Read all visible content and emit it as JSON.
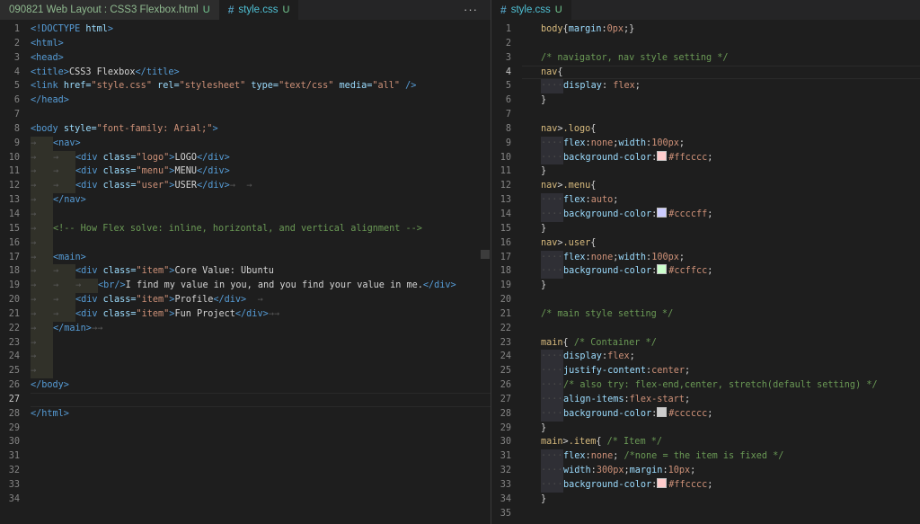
{
  "left_tabs": [
    {
      "label": "090821 Web Layout : CSS3 Flexbox.html",
      "badge": "U",
      "active": false
    },
    {
      "label": "style.css",
      "badge": "U",
      "active": true
    }
  ],
  "right_tab": {
    "label": "style.css",
    "badge": "U"
  },
  "more_actions": "···",
  "html_lines": [
    {
      "n": "1",
      "code": [
        [
          "tg",
          "<!DOCTYPE "
        ],
        [
          "at",
          "html"
        ],
        [
          "tg",
          ">"
        ]
      ]
    },
    {
      "n": "2",
      "code": [
        [
          "tg",
          "<html>"
        ]
      ]
    },
    {
      "n": "3",
      "code": [
        [
          "tg",
          "<head>"
        ]
      ]
    },
    {
      "n": "4",
      "code": [
        [
          "tg",
          "<title>"
        ],
        [
          "pl",
          "CSS3 Flexbox"
        ],
        [
          "tg",
          "</title>"
        ]
      ]
    },
    {
      "n": "5",
      "code": [
        [
          "tg",
          "<link "
        ],
        [
          "at",
          "href="
        ],
        [
          "st",
          "\"style.css\""
        ],
        [
          "pl",
          " "
        ],
        [
          "at",
          "rel="
        ],
        [
          "st",
          "\"stylesheet\""
        ],
        [
          "pl",
          " "
        ],
        [
          "at",
          "type="
        ],
        [
          "st",
          "\"text/css\""
        ],
        [
          "pl",
          " "
        ],
        [
          "at",
          "media="
        ],
        [
          "st",
          "\"all\""
        ],
        [
          "pl",
          " "
        ],
        [
          "tg",
          "/>"
        ]
      ]
    },
    {
      "n": "6",
      "code": [
        [
          "tg",
          "</head>"
        ]
      ]
    },
    {
      "n": "7",
      "code": []
    },
    {
      "n": "8",
      "code": [
        [
          "tg",
          "<body "
        ],
        [
          "at",
          "style="
        ],
        [
          "st",
          "\"font-family: Arial;\""
        ],
        [
          "tg",
          ">"
        ]
      ]
    },
    {
      "n": "9",
      "indent": 1,
      "code": [
        [
          "tg",
          "<nav>"
        ]
      ]
    },
    {
      "n": "10",
      "indent": 2,
      "code": [
        [
          "tg",
          "<div "
        ],
        [
          "at",
          "class="
        ],
        [
          "st",
          "\"logo\""
        ],
        [
          "tg",
          ">"
        ],
        [
          "pl",
          "LOGO"
        ],
        [
          "tg",
          "</div>"
        ]
      ]
    },
    {
      "n": "11",
      "indent": 2,
      "code": [
        [
          "tg",
          "<div "
        ],
        [
          "at",
          "class="
        ],
        [
          "st",
          "\"menu\""
        ],
        [
          "tg",
          ">"
        ],
        [
          "pl",
          "MENU"
        ],
        [
          "tg",
          "</div>"
        ]
      ]
    },
    {
      "n": "12",
      "indent": 2,
      "code": [
        [
          "tg",
          "<div "
        ],
        [
          "at",
          "class="
        ],
        [
          "st",
          "\"user\""
        ],
        [
          "tg",
          ">"
        ],
        [
          "pl",
          "USER"
        ],
        [
          "tg",
          "</div>"
        ],
        [
          "ar",
          "→  →"
        ]
      ]
    },
    {
      "n": "13",
      "indent": 1,
      "code": [
        [
          "tg",
          "</nav>"
        ]
      ]
    },
    {
      "n": "14",
      "indent": 1,
      "code": []
    },
    {
      "n": "15",
      "indent": 1,
      "code": [
        [
          "cm",
          "<!-- How Flex solve: inline, horizontal, and vertical alignment -->"
        ]
      ]
    },
    {
      "n": "16",
      "indent": 1,
      "code": []
    },
    {
      "n": "17",
      "indent": 1,
      "code": [
        [
          "tg",
          "<main>"
        ]
      ]
    },
    {
      "n": "18",
      "indent": 2,
      "code": [
        [
          "tg",
          "<div "
        ],
        [
          "at",
          "class="
        ],
        [
          "st",
          "\"item\""
        ],
        [
          "tg",
          ">"
        ],
        [
          "pl",
          "Core Value: Ubuntu"
        ]
      ]
    },
    {
      "n": "19",
      "indent": 3,
      "code": [
        [
          "tg",
          "<br/>"
        ],
        [
          "pl",
          "I find my value in you, and you find your value in me."
        ],
        [
          "tg",
          "</div>"
        ]
      ]
    },
    {
      "n": "20",
      "indent": 2,
      "code": [
        [
          "tg",
          "<div "
        ],
        [
          "at",
          "class="
        ],
        [
          "st",
          "\"item\""
        ],
        [
          "tg",
          ">"
        ],
        [
          "pl",
          "Profile"
        ],
        [
          "tg",
          "</div>"
        ],
        [
          "ar",
          "  →"
        ]
      ]
    },
    {
      "n": "21",
      "indent": 2,
      "code": [
        [
          "tg",
          "<div "
        ],
        [
          "at",
          "class="
        ],
        [
          "st",
          "\"item\""
        ],
        [
          "tg",
          ">"
        ],
        [
          "pl",
          "Fun Project"
        ],
        [
          "tg",
          "</div>"
        ],
        [
          "ar",
          "→→"
        ]
      ]
    },
    {
      "n": "22",
      "indent": 1,
      "code": [
        [
          "tg",
          "</main>"
        ],
        [
          "ar",
          "→→"
        ]
      ]
    },
    {
      "n": "23",
      "indent": 1,
      "code": []
    },
    {
      "n": "24",
      "indent": 1,
      "code": []
    },
    {
      "n": "25",
      "indent": 1,
      "code": []
    },
    {
      "n": "26",
      "code": [
        [
          "tg",
          "</body>"
        ]
      ]
    },
    {
      "n": "27",
      "code": [],
      "current": true
    },
    {
      "n": "28",
      "code": [
        [
          "tg",
          "</html>"
        ]
      ]
    },
    {
      "n": "29",
      "code": []
    },
    {
      "n": "30",
      "code": []
    },
    {
      "n": "31",
      "code": []
    },
    {
      "n": "32",
      "code": []
    },
    {
      "n": "33",
      "code": []
    },
    {
      "n": "34",
      "code": []
    }
  ],
  "css_lines": [
    {
      "n": "1",
      "code": [
        [
          "sel",
          "body"
        ],
        [
          "pl",
          "{"
        ],
        [
          "pr",
          "margin"
        ],
        [
          "pl",
          ":"
        ],
        [
          "vl",
          "0px"
        ],
        [
          "pl",
          ";}"
        ]
      ]
    },
    {
      "n": "2",
      "code": []
    },
    {
      "n": "3",
      "code": [
        [
          "cm",
          "/* navigator, nav style setting */"
        ]
      ]
    },
    {
      "n": "4",
      "current": true,
      "code": [
        [
          "sel",
          "nav"
        ],
        [
          "pl",
          "{"
        ]
      ]
    },
    {
      "n": "5",
      "indent": 1,
      "code": [
        [
          "pr",
          "display"
        ],
        [
          "pl",
          ": "
        ],
        [
          "vl",
          "flex"
        ],
        [
          "pl",
          ";"
        ]
      ]
    },
    {
      "n": "6",
      "code": [
        [
          "pl",
          "}"
        ]
      ]
    },
    {
      "n": "7",
      "code": []
    },
    {
      "n": "8",
      "code": [
        [
          "sel",
          "nav"
        ],
        [
          "pl",
          ">"
        ],
        [
          "sel",
          ".logo"
        ],
        [
          "pl",
          "{"
        ]
      ]
    },
    {
      "n": "9",
      "indent": 1,
      "code": [
        [
          "pr",
          "flex"
        ],
        [
          "pl",
          ":"
        ],
        [
          "vl",
          "none"
        ],
        [
          "pl",
          ";"
        ],
        [
          "pr",
          "width"
        ],
        [
          "pl",
          ":"
        ],
        [
          "vl",
          "100px"
        ],
        [
          "pl",
          ";"
        ]
      ]
    },
    {
      "n": "10",
      "indent": 1,
      "code": [
        [
          "pr",
          "background-color"
        ],
        [
          "pl",
          ":"
        ],
        [
          "sw",
          "#ffcccc"
        ],
        [
          "vl",
          "#ffcccc"
        ],
        [
          "pl",
          ";"
        ]
      ]
    },
    {
      "n": "11",
      "code": [
        [
          "pl",
          "}"
        ]
      ]
    },
    {
      "n": "12",
      "code": [
        [
          "sel",
          "nav"
        ],
        [
          "pl",
          ">"
        ],
        [
          "sel",
          ".menu"
        ],
        [
          "pl",
          "{"
        ]
      ]
    },
    {
      "n": "13",
      "indent": 1,
      "code": [
        [
          "pr",
          "flex"
        ],
        [
          "pl",
          ":"
        ],
        [
          "vl",
          "auto"
        ],
        [
          "pl",
          ";"
        ]
      ]
    },
    {
      "n": "14",
      "indent": 1,
      "code": [
        [
          "pr",
          "background-color"
        ],
        [
          "pl",
          ":"
        ],
        [
          "sw",
          "#ccccff"
        ],
        [
          "vl",
          "#ccccff"
        ],
        [
          "pl",
          ";"
        ]
      ]
    },
    {
      "n": "15",
      "code": [
        [
          "pl",
          "}"
        ]
      ]
    },
    {
      "n": "16",
      "code": [
        [
          "sel",
          "nav"
        ],
        [
          "pl",
          ">"
        ],
        [
          "sel",
          ".user"
        ],
        [
          "pl",
          "{"
        ]
      ]
    },
    {
      "n": "17",
      "indent": 1,
      "code": [
        [
          "pr",
          "flex"
        ],
        [
          "pl",
          ":"
        ],
        [
          "vl",
          "none"
        ],
        [
          "pl",
          ";"
        ],
        [
          "pr",
          "width"
        ],
        [
          "pl",
          ":"
        ],
        [
          "vl",
          "100px"
        ],
        [
          "pl",
          ";"
        ]
      ]
    },
    {
      "n": "18",
      "indent": 1,
      "code": [
        [
          "pr",
          "background-color"
        ],
        [
          "pl",
          ":"
        ],
        [
          "sw",
          "#ccffcc"
        ],
        [
          "vl",
          "#ccffcc"
        ],
        [
          "pl",
          ";"
        ]
      ]
    },
    {
      "n": "19",
      "code": [
        [
          "pl",
          "}"
        ]
      ]
    },
    {
      "n": "20",
      "code": []
    },
    {
      "n": "21",
      "code": [
        [
          "cm",
          "/* main style setting */"
        ]
      ]
    },
    {
      "n": "22",
      "code": []
    },
    {
      "n": "23",
      "code": [
        [
          "sel",
          "main"
        ],
        [
          "pl",
          "{ "
        ],
        [
          "cm",
          "/* Container */"
        ]
      ]
    },
    {
      "n": "24",
      "indent": 1,
      "code": [
        [
          "pr",
          "display"
        ],
        [
          "pl",
          ":"
        ],
        [
          "vl",
          "flex"
        ],
        [
          "pl",
          ";"
        ]
      ]
    },
    {
      "n": "25",
      "indent": 1,
      "code": [
        [
          "pr",
          "justify-content"
        ],
        [
          "pl",
          ":"
        ],
        [
          "vl",
          "center"
        ],
        [
          "pl",
          ";"
        ]
      ]
    },
    {
      "n": "26",
      "indent": 1,
      "code": [
        [
          "cm",
          "/* also try: flex-end,center, stretch(default setting) */"
        ]
      ]
    },
    {
      "n": "27",
      "indent": 1,
      "code": [
        [
          "pr",
          "align-items"
        ],
        [
          "pl",
          ":"
        ],
        [
          "vl",
          "flex-start"
        ],
        [
          "pl",
          ";"
        ]
      ]
    },
    {
      "n": "28",
      "indent": 1,
      "code": [
        [
          "pr",
          "background-color"
        ],
        [
          "pl",
          ":"
        ],
        [
          "sw",
          "#cccccc"
        ],
        [
          "vl",
          "#cccccc"
        ],
        [
          "pl",
          ";"
        ]
      ]
    },
    {
      "n": "29",
      "code": [
        [
          "pl",
          "}"
        ]
      ]
    },
    {
      "n": "30",
      "code": [
        [
          "sel",
          "main"
        ],
        [
          "pl",
          ">"
        ],
        [
          "sel",
          ".item"
        ],
        [
          "pl",
          "{ "
        ],
        [
          "cm",
          "/* Item */"
        ]
      ]
    },
    {
      "n": "31",
      "indent": 1,
      "code": [
        [
          "pr",
          "flex"
        ],
        [
          "pl",
          ":"
        ],
        [
          "vl",
          "none"
        ],
        [
          "pl",
          "; "
        ],
        [
          "cm",
          "/*none = the item is fixed */"
        ]
      ]
    },
    {
      "n": "32",
      "indent": 1,
      "code": [
        [
          "pr",
          "width"
        ],
        [
          "pl",
          ":"
        ],
        [
          "vl",
          "300px"
        ],
        [
          "pl",
          ";"
        ],
        [
          "pr",
          "margin"
        ],
        [
          "pl",
          ":"
        ],
        [
          "vl",
          "10px"
        ],
        [
          "pl",
          ";"
        ]
      ]
    },
    {
      "n": "33",
      "indent": 1,
      "code": [
        [
          "pr",
          "background-color"
        ],
        [
          "pl",
          ":"
        ],
        [
          "sw",
          "#ffcccc"
        ],
        [
          "vl",
          "#ffcccc"
        ],
        [
          "pl",
          ";"
        ]
      ]
    },
    {
      "n": "34",
      "code": [
        [
          "pl",
          "}"
        ]
      ]
    },
    {
      "n": "35",
      "code": []
    }
  ]
}
